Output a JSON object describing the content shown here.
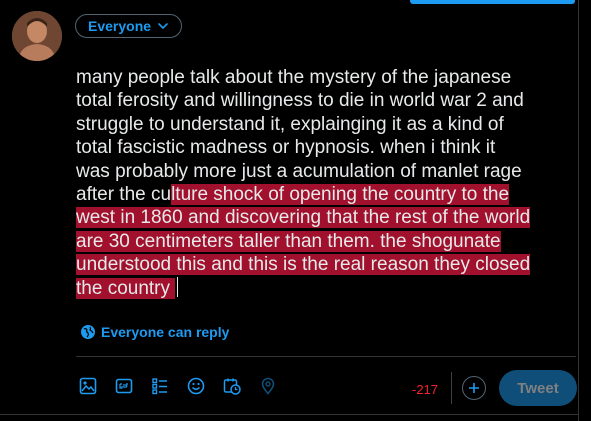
{
  "composer": {
    "audience_label": "Everyone",
    "text_lines": [
      {
        "plain": "many people talk about the mystery of the japanese",
        "highlighted": ""
      },
      {
        "plain": "total ferosity and willingness to die in world war 2 and",
        "highlighted": ""
      },
      {
        "plain": "struggle to understand it, explainging it as a kind of",
        "highlighted": ""
      },
      {
        "plain": "total fascistic madness or hypnosis. when i think it",
        "highlighted": ""
      },
      {
        "plain": "was probably more just a acumulation of manlet rage",
        "highlighted": ""
      },
      {
        "plain": "after the cu",
        "highlighted": "lture shock of opening the country to the"
      },
      {
        "plain": "",
        "highlighted": "west in 1860 and discovering that the rest of the world"
      },
      {
        "plain": "",
        "highlighted": "are 30 centimeters taller than them. the shogunate"
      },
      {
        "plain": "",
        "highlighted": "understood this and this is the real reason they closed"
      },
      {
        "plain": "",
        "highlighted": "the country "
      }
    ],
    "reply_setting": "Everyone can reply",
    "char_count": "-217",
    "tweet_label": "Tweet"
  },
  "toolbar": {
    "icons": [
      "media-icon",
      "gif-icon",
      "poll-icon",
      "emoji-icon",
      "schedule-icon",
      "location-icon"
    ]
  },
  "colors": {
    "accent": "#1d9bf0",
    "highlight": "#a1102c",
    "over_limit": "#f4212e",
    "tweet_disabled": "#0f4e78"
  }
}
